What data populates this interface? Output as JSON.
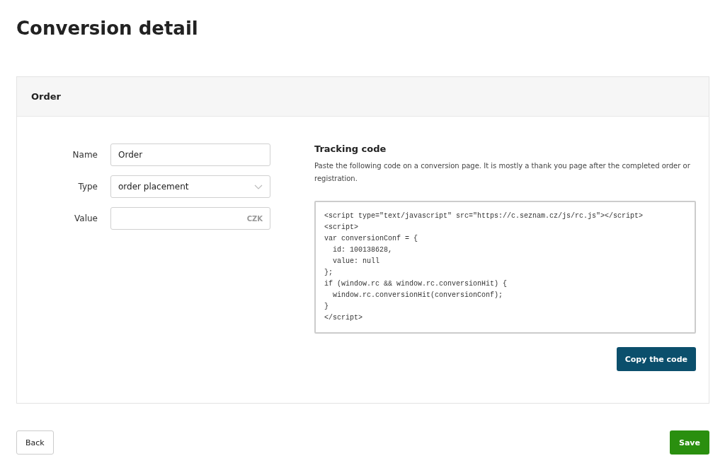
{
  "page_title": "Conversion detail",
  "panel": {
    "title": "Order"
  },
  "form": [
    {
      "kind": "text",
      "label": "Name",
      "value": "Order"
    },
    {
      "kind": "select",
      "label": "Type",
      "value": "order placement"
    },
    {
      "kind": "currency",
      "label": "Value",
      "suffix": "CZK"
    }
  ],
  "tracking": {
    "title": "Tracking code",
    "description": "Paste the following code on a conversion page. It is mostly a thank you page after the completed order or registration.",
    "code_lines": [
      "<script type=\"text/javascript\" src=\"https://c.seznam.cz/js/rc.js\"></script>",
      "<script>",
      "var conversionConf = {",
      "  id: 100138628,",
      "  value: null",
      "};",
      "if (window.rc && window.rc.conversionHit) {",
      "  window.rc.conversionHit(conversionConf);",
      "}",
      "</script>"
    ],
    "copy_button": "Copy the code"
  },
  "buttons": {
    "back": "Back",
    "save": "Save"
  }
}
